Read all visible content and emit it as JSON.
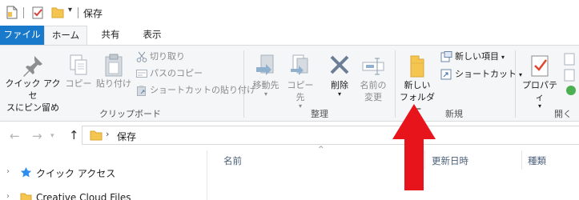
{
  "window": {
    "title": "保存",
    "qat_dropdown": "▾"
  },
  "tabs": {
    "file": "ファイル",
    "home": "ホーム",
    "share": "共有",
    "view": "表示"
  },
  "ribbon": {
    "clipboard": {
      "group_label": "クリップボード",
      "pin_quick_access_line1": "クイック アクセ",
      "pin_quick_access_line2": "スにピン留め",
      "copy": "コピー",
      "paste": "貼り付け",
      "cut": "切り取り",
      "copy_path": "パスのコピー",
      "paste_shortcut": "ショートカットの貼り付け"
    },
    "organize": {
      "group_label": "整理",
      "move_to": "移動先",
      "copy_to": "コピー先",
      "delete": "削除",
      "rename_line1": "名前の",
      "rename_line2": "変更"
    },
    "new": {
      "group_label": "新規",
      "new_folder_line1": "新しい",
      "new_folder_line2": "フォルダー",
      "new_item": "新しい項目",
      "shortcut": "ショートカット"
    },
    "open": {
      "group_label": "開く",
      "properties": "プロパティ"
    }
  },
  "address_bar": {
    "chevron": "›",
    "path": "保存"
  },
  "nav_pane": {
    "items": [
      {
        "label": "クイック アクセス"
      },
      {
        "label": "Creative Cloud Files"
      }
    ]
  },
  "file_list": {
    "columns": [
      "名前",
      "更新日時",
      "種類"
    ]
  },
  "colors": {
    "file_tab": "#1979ca",
    "ribbon_bg": "#f5f6f7",
    "annotation_arrow": "#e8141b"
  }
}
